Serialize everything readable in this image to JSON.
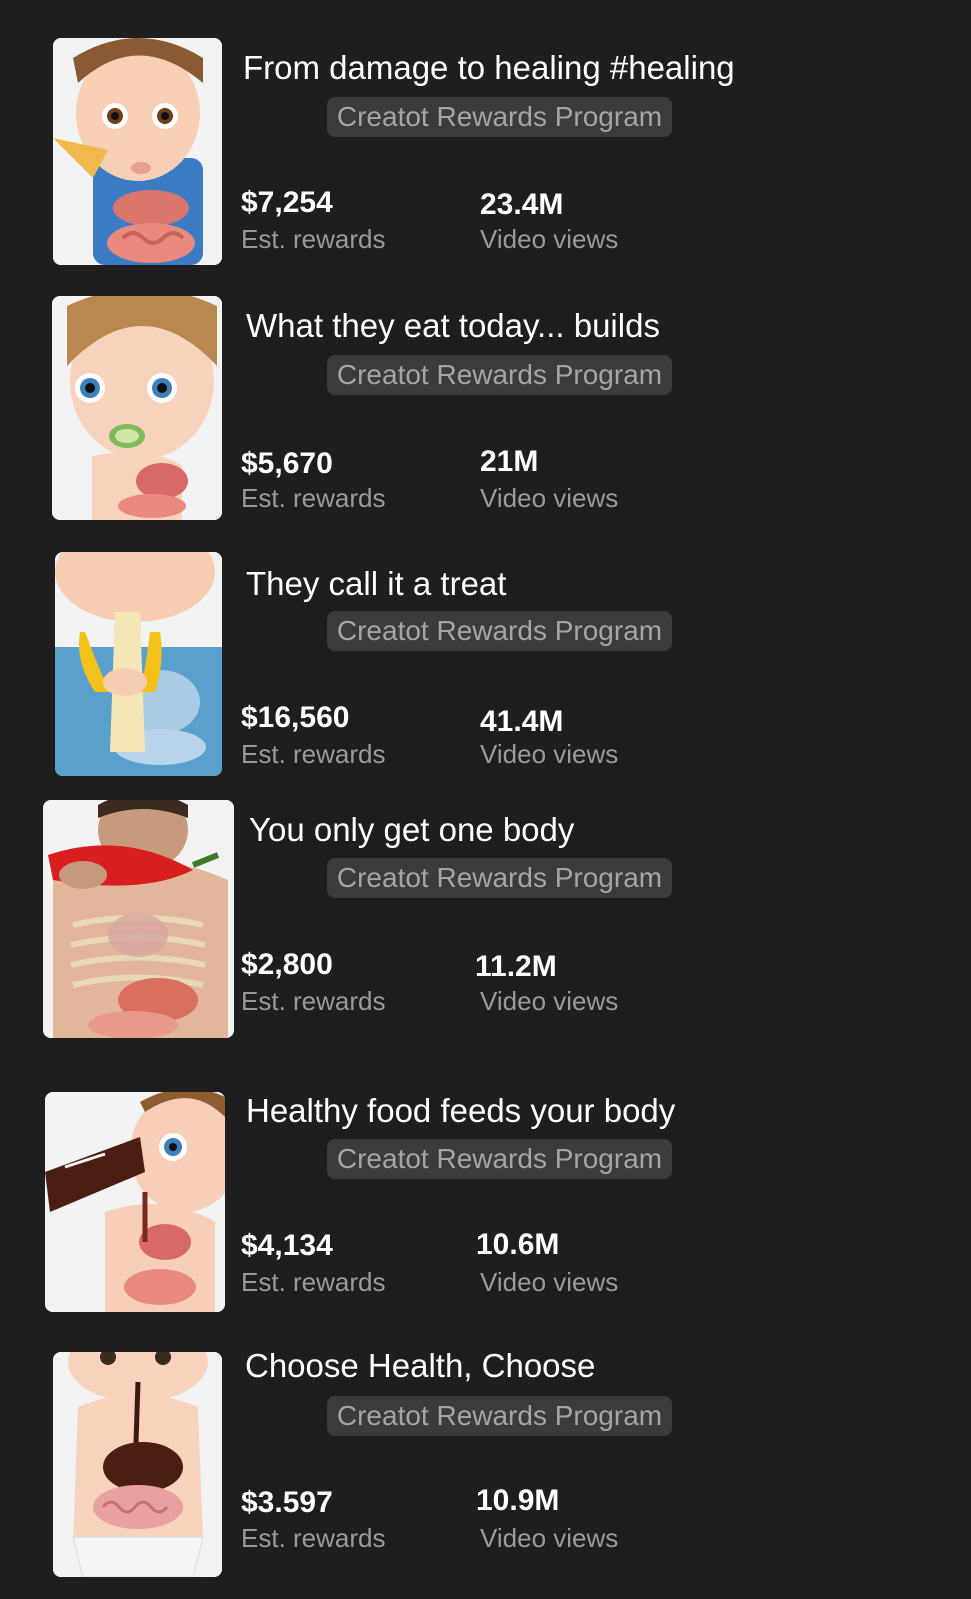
{
  "videos": [
    {
      "title": "From damage to healing #healing",
      "badge": "Creatot Rewards Program",
      "rewards": "$7,254",
      "rewards_label": "Est. rewards",
      "views": "23.4M",
      "views_label": "Video views",
      "thumbnail": "cartoon-child-eating-pizza-digestive-system-thumbnail"
    },
    {
      "title": "What they eat today... builds",
      "badge": "Creatot Rewards Program",
      "rewards": "$5,670",
      "rewards_label": "Est. rewards",
      "views": "21M",
      "views_label": "Video views",
      "thumbnail": "cartoon-child-eating-cucumber-thumbnail"
    },
    {
      "title": "They call it a treat",
      "badge": "Creatot Rewards Program",
      "rewards": "$16,560",
      "rewards_label": "Est. rewards",
      "views": "41.4M",
      "views_label": "Video views",
      "thumbnail": "cartoon-child-eating-banana-thumbnail"
    },
    {
      "title": "You only get one body",
      "badge": "Creatot Rewards Program",
      "rewards": "$2,800",
      "rewards_label": "Est. rewards",
      "views": "11.2M",
      "views_label": "Video views",
      "thumbnail": "man-eating-chili-pepper-anatomy-thumbnail"
    },
    {
      "title": "Healthy food feeds your body",
      "badge": "Creatot Rewards Program",
      "rewards": "$4,134",
      "rewards_label": "Est. rewards",
      "views": "10.6M",
      "views_label": "Video views",
      "thumbnail": "cartoon-child-drinking-cola-thumbnail"
    },
    {
      "title": "Choose Health, Choose",
      "badge": "Creatot Rewards Program",
      "rewards": "$3.597",
      "rewards_label": "Est. rewards",
      "views": "10.9M",
      "views_label": "Video views",
      "thumbnail": "cartoon-baby-cola-digestive-system-thumbnail"
    }
  ],
  "colors": {
    "background": "#1e1e1e",
    "badge_bg": "#3b3b3b",
    "badge_text": "#a5a5a5",
    "label_text": "#9a9a9a"
  }
}
